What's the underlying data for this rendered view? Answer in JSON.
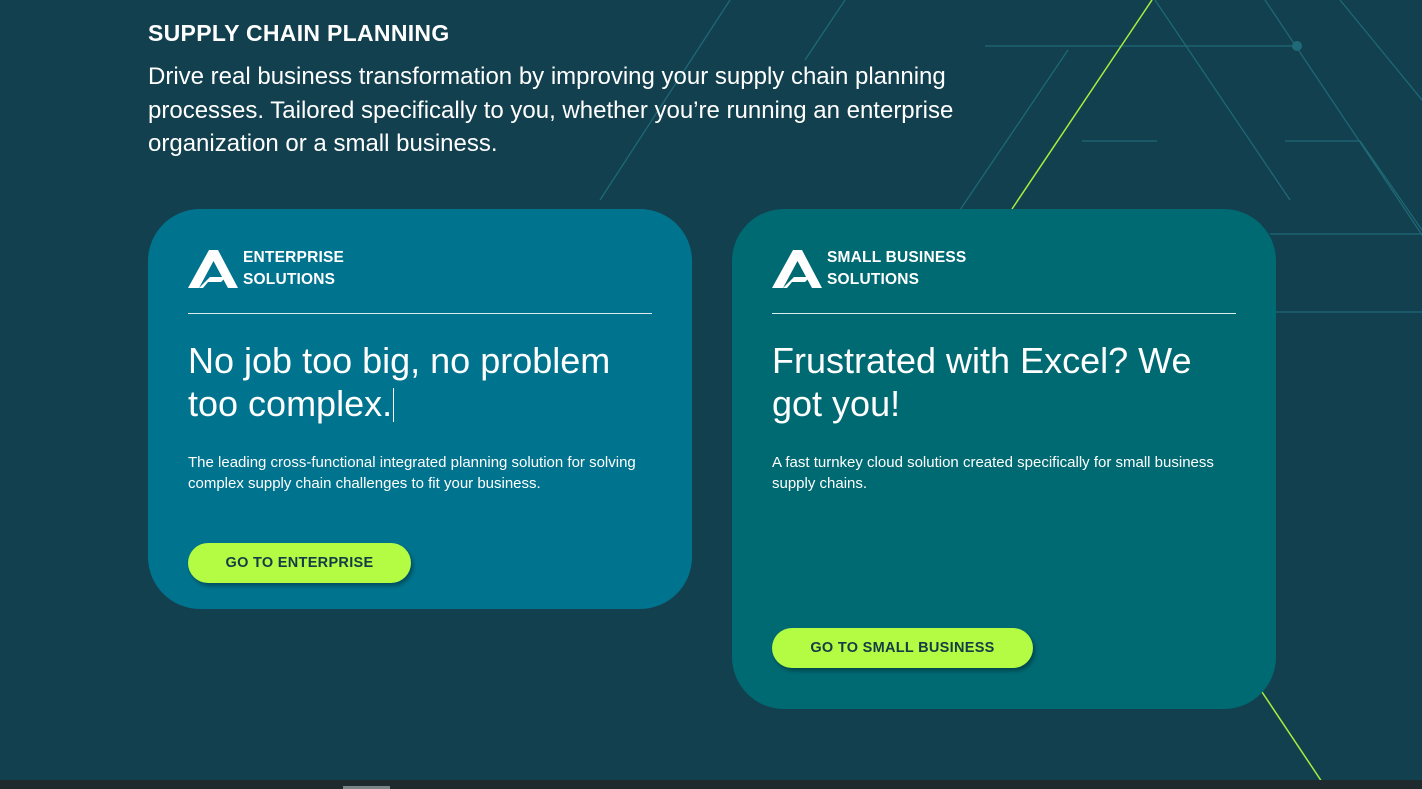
{
  "section": {
    "title": "SUPPLY CHAIN PLANNING",
    "intro": "Drive real business transformation by improving your supply chain planning processes. Tailored specifically to you, whether you’re running an enterprise organization or a small business."
  },
  "cards": [
    {
      "brand_line1": "ENTERPRISE",
      "brand_line2": "SOLUTIONS",
      "headline": "No job too big, no problem too complex.",
      "description": "The leading cross-functional integrated planning solution for solving complex supply chain challenges to fit your business.",
      "cta_label": "GO TO ENTERPRISE",
      "background": "#00748f"
    },
    {
      "brand_line1": "SMALL BUSINESS",
      "brand_line2": "SOLUTIONS",
      "headline": "Frustrated with Excel? We got you!",
      "description": "A fast turnkey cloud solution created specifically for small business supply chains.",
      "cta_label": "GO TO SMALL BUSINESS",
      "background": "#006a73"
    }
  ],
  "icons": {
    "brand_logo": "brand-logo-icon"
  },
  "colors": {
    "page_background": "#13404e",
    "accent": "#b4fb43",
    "cta_text": "#133c46",
    "decor_line": "#1f6a78"
  }
}
